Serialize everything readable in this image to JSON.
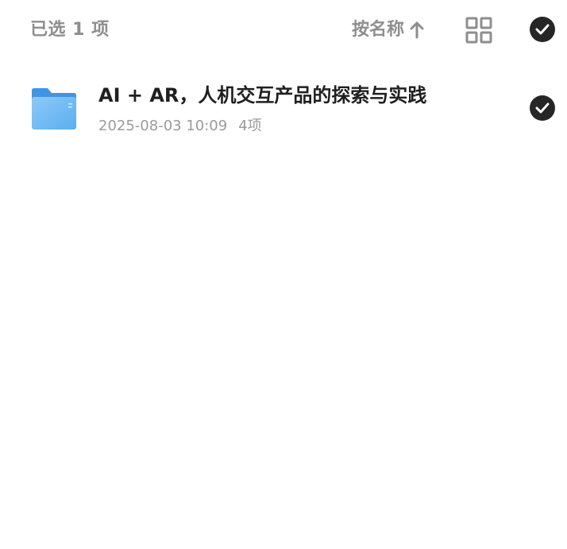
{
  "header": {
    "selected_label": "已选 1 项",
    "sort_label": "按名称",
    "sort_direction_icon": "arrow-up-icon",
    "view_toggle_icon": "grid-view-icon",
    "select_all_icon": "check-circle-icon"
  },
  "items": [
    {
      "type_icon": "folder-icon",
      "name": "AI + AR，人机交互产品的探索与实践",
      "modified": "2025-08-03 10:09",
      "count": "4项",
      "selected": true
    }
  ],
  "colors": {
    "muted_text": "#8e8e8e",
    "check_fill": "#262626",
    "folder_blue": "#5aaef0"
  }
}
